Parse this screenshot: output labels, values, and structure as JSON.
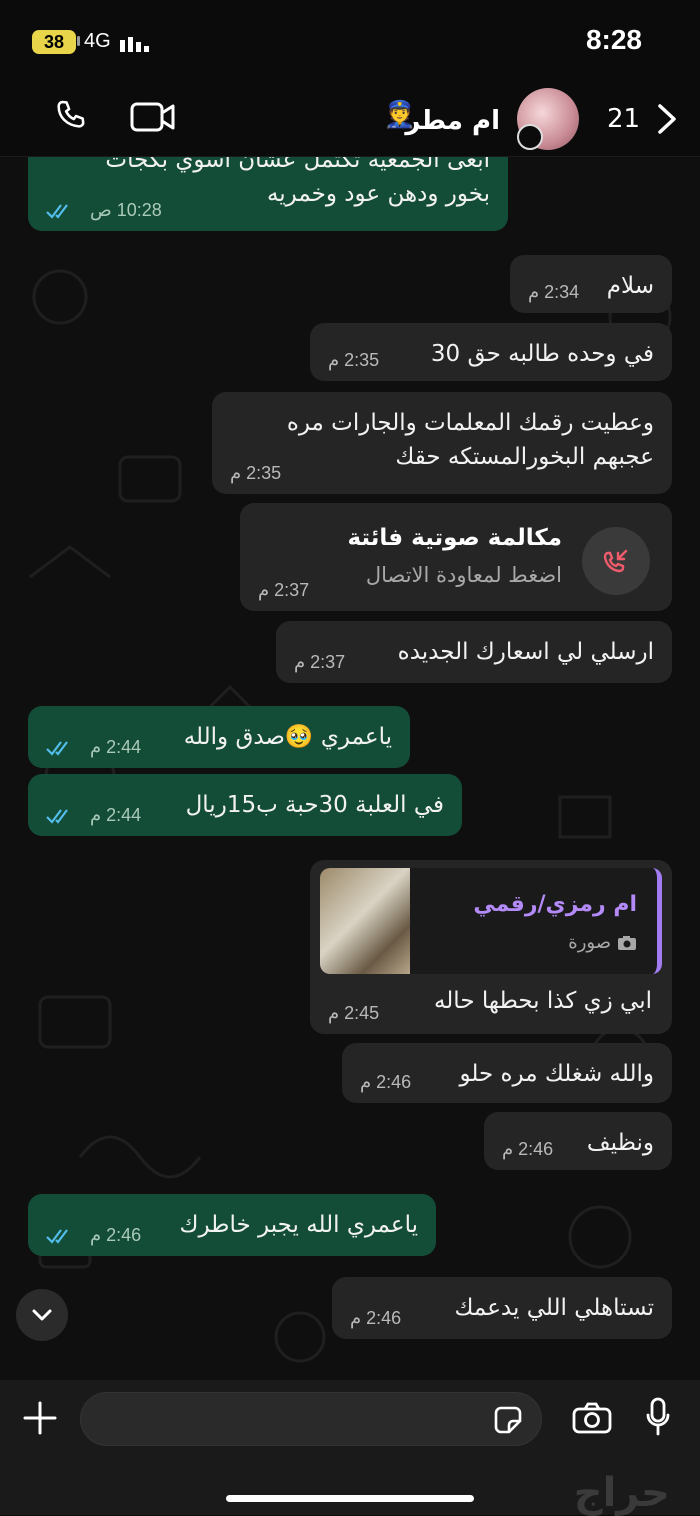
{
  "status_bar": {
    "battery": "38",
    "network": "4G",
    "time": "8:28"
  },
  "header": {
    "contact_name": "ام مطر",
    "contact_emoji": "👮",
    "unread_count": "21",
    "icons": [
      "phone-icon",
      "video-call-icon",
      "chevron-right-icon",
      "disappearing-timer-icon"
    ]
  },
  "messages": [
    {
      "dir": "out",
      "lines": [
        "ابغى الجمعية تكتمل عشان اسوي بكجات",
        "بخور ودهن عود وخمريه"
      ],
      "time": "10:28 ص",
      "read": true
    },
    {
      "dir": "in",
      "lines": [
        "سلام"
      ],
      "time": "2:34 م"
    },
    {
      "dir": "in",
      "lines": [
        "في وحده طالبه حق 30"
      ],
      "time": "2:35 م"
    },
    {
      "dir": "in",
      "lines": [
        "وعطيت رقمك المعلمات والجارات مره",
        "عجبهم البخورالمستكه حقك"
      ],
      "time": "2:35 م"
    },
    {
      "dir": "in",
      "type": "missed_call",
      "title": "مكالمة صوتية فائتة",
      "subtitle": "اضغط لمعاودة الاتصال",
      "time": "2:37 م"
    },
    {
      "dir": "in",
      "lines": [
        "ارسلي لي اسعارك الجديده"
      ],
      "time": "2:37 م"
    },
    {
      "dir": "out",
      "lines": [
        "ياعمري 🥹صدق والله"
      ],
      "time": "2:44 م",
      "read": true
    },
    {
      "dir": "out",
      "lines": [
        "في العلبة 30حبة ب15ريال"
      ],
      "time": "2:44 م",
      "read": true
    },
    {
      "dir": "in",
      "type": "reply",
      "quote_name": "ام رمزي/رقمي",
      "quote_sub": "صورة",
      "lines": [
        "ابي زي كذا بحطها حاله"
      ],
      "time": "2:45 م"
    },
    {
      "dir": "in",
      "lines": [
        "والله شغلك مره حلو"
      ],
      "time": "2:46 م"
    },
    {
      "dir": "in",
      "lines": [
        "ونظيف"
      ],
      "time": "2:46 م"
    },
    {
      "dir": "out",
      "lines": [
        "ياعمري الله يجبر خاطرك"
      ],
      "time": "2:46 م",
      "read": true
    },
    {
      "dir": "in",
      "lines": [
        "تستاهلي اللي يدعمك"
      ],
      "time": "2:46 م"
    }
  ],
  "composer": {
    "placeholder": "",
    "icons": [
      "plus-icon",
      "sticker-icon",
      "camera-icon",
      "microphone-icon"
    ]
  },
  "watermark": "حراج",
  "colors": {
    "incoming_bubble": "#252525",
    "outgoing_bubble": "#144d37",
    "read_ticks": "#53bdeb",
    "quote_accent": "#a27cf0",
    "missed_call": "#f15c6d"
  }
}
